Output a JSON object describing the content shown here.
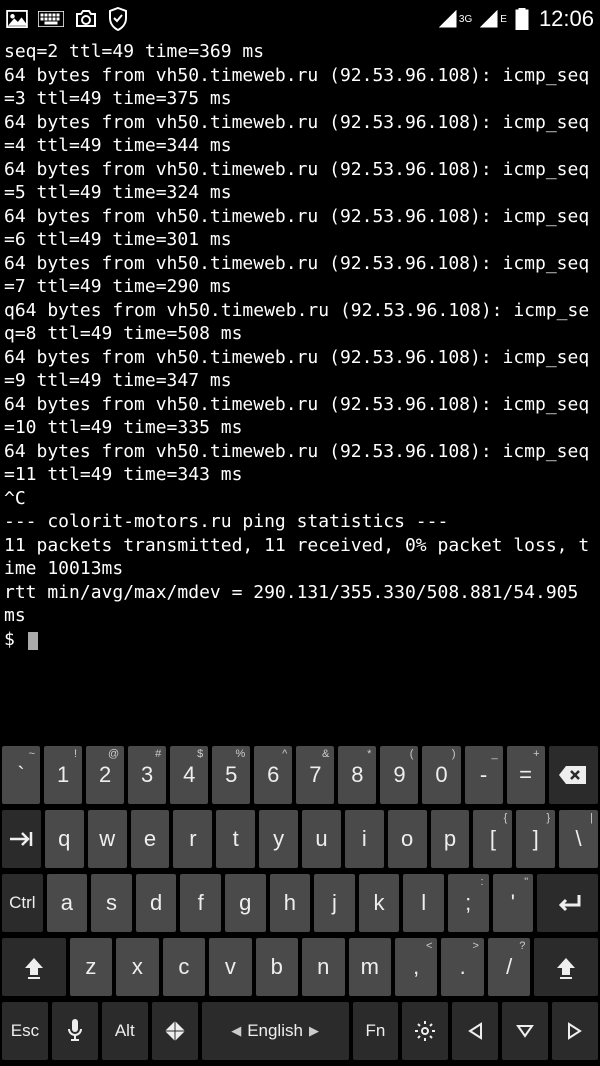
{
  "statusbar": {
    "time": "12:06",
    "net1_label": "3G",
    "net2_label": "E"
  },
  "terminal": {
    "lines": [
      "seq=2 ttl=49 time=369 ms",
      "64 bytes from vh50.timeweb.ru (92.53.96.108): icmp_seq=3 ttl=49 time=375 ms",
      "64 bytes from vh50.timeweb.ru (92.53.96.108): icmp_seq=4 ttl=49 time=344 ms",
      "64 bytes from vh50.timeweb.ru (92.53.96.108): icmp_seq=5 ttl=49 time=324 ms",
      "64 bytes from vh50.timeweb.ru (92.53.96.108): icmp_seq=6 ttl=49 time=301 ms",
      "64 bytes from vh50.timeweb.ru (92.53.96.108): icmp_seq=7 ttl=49 time=290 ms",
      "q64 bytes from vh50.timeweb.ru (92.53.96.108): icmp_seq=8 ttl=49 time=508 ms",
      "64 bytes from vh50.timeweb.ru (92.53.96.108): icmp_seq=9 ttl=49 time=347 ms",
      "64 bytes from vh50.timeweb.ru (92.53.96.108): icmp_seq=10 ttl=49 time=335 ms",
      "64 bytes from vh50.timeweb.ru (92.53.96.108): icmp_seq=11 ttl=49 time=343 ms",
      "^C",
      "--- colorit-motors.ru ping statistics ---",
      "11 packets transmitted, 11 received, 0% packet loss, time 10013ms",
      "rtt min/avg/max/mdev = 290.131/355.330/508.881/54.905 ms",
      "$ "
    ]
  },
  "keyboard": {
    "row1": [
      {
        "main": "`",
        "alt": "~"
      },
      {
        "main": "1",
        "alt": "!"
      },
      {
        "main": "2",
        "alt": "@"
      },
      {
        "main": "3",
        "alt": "#"
      },
      {
        "main": "4",
        "alt": "$"
      },
      {
        "main": "5",
        "alt": "%"
      },
      {
        "main": "6",
        "alt": "^"
      },
      {
        "main": "7",
        "alt": "&"
      },
      {
        "main": "8",
        "alt": "*"
      },
      {
        "main": "9",
        "alt": "("
      },
      {
        "main": "0",
        "alt": ")"
      },
      {
        "main": "-",
        "alt": "_"
      },
      {
        "main": "=",
        "alt": "+"
      }
    ],
    "row2": [
      {
        "main": "q"
      },
      {
        "main": "w"
      },
      {
        "main": "e"
      },
      {
        "main": "r"
      },
      {
        "main": "t"
      },
      {
        "main": "y"
      },
      {
        "main": "u"
      },
      {
        "main": "i"
      },
      {
        "main": "o"
      },
      {
        "main": "p"
      },
      {
        "main": "[",
        "alt": "{"
      },
      {
        "main": "]",
        "alt": "}"
      },
      {
        "main": "\\",
        "alt": "|"
      }
    ],
    "row3_ctrl": "Ctrl",
    "row3": [
      {
        "main": "a"
      },
      {
        "main": "s"
      },
      {
        "main": "d"
      },
      {
        "main": "f"
      },
      {
        "main": "g"
      },
      {
        "main": "h"
      },
      {
        "main": "j"
      },
      {
        "main": "k"
      },
      {
        "main": "l"
      },
      {
        "main": ";",
        "alt": ":"
      },
      {
        "main": "'",
        "alt": "\""
      }
    ],
    "row4": [
      {
        "main": "z"
      },
      {
        "main": "x"
      },
      {
        "main": "c"
      },
      {
        "main": "v"
      },
      {
        "main": "b"
      },
      {
        "main": "n"
      },
      {
        "main": "m"
      },
      {
        "main": ",",
        "alt": "<"
      },
      {
        "main": ".",
        "alt": ">"
      },
      {
        "main": "/",
        "alt": "?"
      }
    ],
    "row5": {
      "esc": "Esc",
      "alt": "Alt",
      "lang": "English",
      "fn": "Fn"
    }
  }
}
